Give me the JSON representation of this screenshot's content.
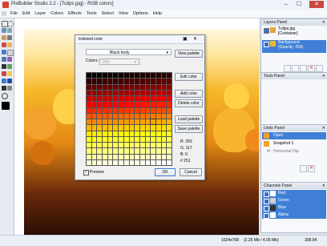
{
  "window": {
    "title": "PixBuilder Studio 2.2 - [Tulips.jpg] - RGB colors]",
    "min": "–",
    "max": "☐",
    "close": "✕"
  },
  "menu": [
    "File",
    "Edit",
    "Layer",
    "Colors",
    "Effects",
    "Tools",
    "Select",
    "View",
    "Options",
    "Help"
  ],
  "colors": {
    "accent": "#3f7fd6",
    "red": "#e24a3b",
    "green": "#3cb55c",
    "blue": "#3b78d8"
  },
  "dialog": {
    "title": "Indexed color",
    "palette_value": "Black body",
    "colors_label": "Colors:",
    "colors_value": "256",
    "buttons": {
      "view_palette": "View palette",
      "edit_color": "Edit color",
      "add_color": "Add color",
      "delete_color": "Delete color",
      "load_palette": "Load palette",
      "save_palette": "Save palette",
      "ok": "OK",
      "cancel": "Cancel"
    },
    "rgb": {
      "r": "R: 255",
      "g": "G: 117",
      "b": "B: 0",
      "index": "# 251"
    },
    "preview_label": "Preview"
  },
  "layers_panel": {
    "title": "Layers Panel",
    "items": [
      {
        "name": "Tulips.jpg",
        "sub": "[Container]"
      },
      {
        "name": "Background",
        "sub": "(Opacity: 256)"
      }
    ]
  },
  "tools_panel": {
    "title": "Tools Panel"
  },
  "undo_panel": {
    "title": "Undo Panel",
    "items": [
      "Open",
      "Snapshot 1",
      "Horizontal Flip"
    ]
  },
  "channels_panel": {
    "title": "Channels Panel",
    "items": [
      "Red",
      "Green",
      "Blue",
      "Alpha"
    ]
  },
  "status": {
    "dimensions": "1024x768",
    "memory": "(2.25 Mb / 4.05 Mb)",
    "zoom": "308.94"
  }
}
